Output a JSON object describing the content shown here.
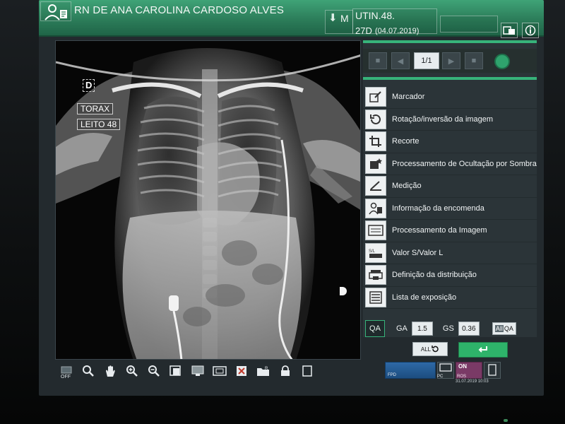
{
  "header": {
    "patient_name": "RN DE ANA CAROLINA CARDOSO ALVES",
    "sex": "M",
    "ward": "UTIN.48.",
    "age": "27D",
    "date": "(04.07.2019)"
  },
  "image_overlay": {
    "orientation": "D",
    "exam": "TORAX",
    "bed": "LEITO 48"
  },
  "toolbar": {
    "off_label": "OFF",
    "icons": [
      "display-off-icon",
      "zoom-icon",
      "pan-hand-icon",
      "zoom-in-icon",
      "zoom-out-icon",
      "fit-icon",
      "monitor-icon",
      "split-icon",
      "reject-icon",
      "folder-icon",
      "lock-icon",
      "blank-icon"
    ]
  },
  "panel": {
    "page_indicator": "1/1",
    "menu": [
      {
        "label": "Marcador",
        "icon": "marker-icon"
      },
      {
        "label": "Rotação/inversão da imagem",
        "icon": "rotate-icon"
      },
      {
        "label": "Recorte",
        "icon": "crop-icon"
      },
      {
        "label": "Processamento de Ocultação por Sombra",
        "icon": "shadow-mask-icon"
      },
      {
        "label": "Medição",
        "icon": "measure-icon"
      },
      {
        "label": "Informação da encomenda",
        "icon": "order-info-icon"
      },
      {
        "label": "Processamento da Imagem",
        "icon": "image-processing-icon"
      },
      {
        "label": "Valor S/Valor L",
        "icon": "sl-value-icon"
      },
      {
        "label": "Definição da distribuição",
        "icon": "distribution-icon"
      },
      {
        "label": "Lista de exposição",
        "icon": "exposure-list-icon"
      }
    ],
    "qa": {
      "qa_label": "QA",
      "ga_label": "GA",
      "ga_value": "1.5",
      "gs_label": "GS",
      "gs_value": "0.36",
      "allqa_all": "All",
      "allqa_qa": "QA"
    },
    "all_button": "ALL",
    "ok_button_icon": "return-arrow-icon"
  },
  "status": {
    "fpd": "FPD",
    "pc": "PC",
    "ros": "ROS",
    "on": "ON",
    "datetime": "31.07.2019 10:03"
  },
  "colors": {
    "header_green": "#2c7d5a",
    "accent_green": "#37b37a",
    "panel_bg": "#2b3438",
    "fpd_blue": "#1c4d80",
    "ros_purple": "#7a3a66"
  }
}
